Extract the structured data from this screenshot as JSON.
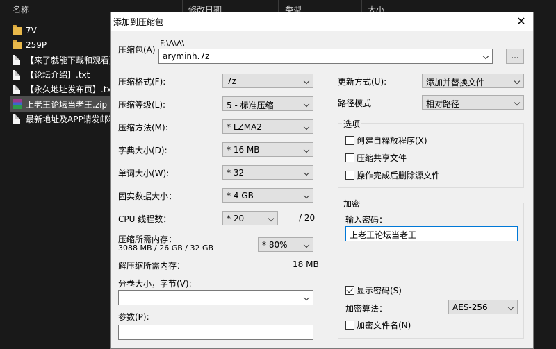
{
  "explorer": {
    "columns": [
      "名称",
      "修改日期",
      "类型",
      "大小"
    ],
    "files": [
      {
        "name": "7V",
        "icon": "folder-icon"
      },
      {
        "name": "259P",
        "icon": "folder-icon"
      },
      {
        "name": "【来了就能下载和观看】",
        "icon": "file-icon"
      },
      {
        "name": "【论坛介绍】.txt",
        "icon": "file-icon"
      },
      {
        "name": "【永久地址发布页】.txt",
        "icon": "file-icon"
      },
      {
        "name": "上老王论坛当老王.zip",
        "icon": "zip-icon",
        "selected": true
      },
      {
        "name": "最新地址及APP请发邮箱",
        "icon": "file-icon"
      }
    ]
  },
  "dialog": {
    "title": "添加到压缩包",
    "close_glyph": "✕",
    "archive": {
      "label": "压缩包(A)",
      "path": "F:\\A\\A\\",
      "filename": "aryminh.7z",
      "browse_label": "..."
    },
    "left": {
      "format": {
        "label": "压缩格式(F):",
        "value": "7z"
      },
      "level": {
        "label": "压缩等级(L):",
        "value": "5 - 标准压缩"
      },
      "method": {
        "label": "压缩方法(M):",
        "value": "* LZMA2"
      },
      "dict": {
        "label": "字典大小(D):",
        "value": "* 16 MB"
      },
      "word": {
        "label": "单词大小(W):",
        "value": "* 32"
      },
      "solid": {
        "label": "固实数据大小：",
        "value": "* 4 GB"
      },
      "cpu": {
        "label": "CPU 线程数：",
        "value": "* 20",
        "max": "/ 20"
      },
      "memory": {
        "label": "压缩所需内存：",
        "detail": "3088 MB / 26 GB / 32 GB",
        "value": "* 80%"
      },
      "decompress": {
        "label": "解压缩所需内存：",
        "value": "18 MB"
      },
      "split": {
        "label": "分卷大小，字节(V):",
        "value": ""
      },
      "params": {
        "label": "参数(P):",
        "value": ""
      }
    },
    "right": {
      "update": {
        "label": "更新方式(U):",
        "value": "添加并替换文件"
      },
      "pathmode": {
        "label": "路径模式",
        "value": "相对路径"
      },
      "options": {
        "title": "选项",
        "sfx": {
          "label": "创建自释放程序(X)",
          "checked": false
        },
        "shared": {
          "label": "压缩共享文件",
          "checked": false
        },
        "delete": {
          "label": "操作完成后删除源文件",
          "checked": false
        }
      },
      "encryption": {
        "title": "加密",
        "password_label": "输入密码：",
        "password": "上老王论坛当老王",
        "show_password": {
          "label": "显示密码(S)",
          "checked": true
        },
        "method_label": "加密算法：",
        "method": "AES-256",
        "encrypt_names": {
          "label": "加密文件名(N)",
          "checked": false
        }
      }
    }
  },
  "colors": {
    "dialog_bg": "#f0f0f0",
    "explorer_bg": "#191919",
    "focus_border": "#0078d7"
  }
}
